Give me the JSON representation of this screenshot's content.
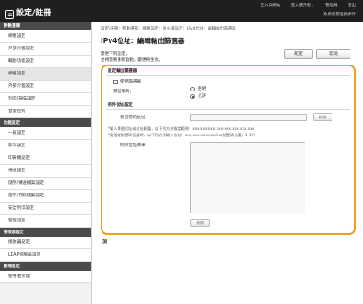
{
  "header": {
    "logo_text": "遠端使用者介面",
    "logo_short": "設定/註冊",
    "links": [
      "至入口網站",
      "登入使用者：",
      "管理員",
      "登出"
    ],
    "sub_link": "致系統管理員郵件"
  },
  "sidebar": {
    "sections": [
      {
        "title": "參數選擇",
        "items": [
          "網路設定",
          "外部介面設定",
          "輔助功能設定",
          "網路設定",
          "外部介面設定",
          "列印/掃描設定",
          "音量控制"
        ]
      },
      {
        "title": "功能設定",
        "items": [
          "一般設定",
          "影印設定",
          "印表機設定",
          "傳送設定",
          "儲存/傳送檔案設定",
          "當存/存取檔案設定",
          "安全列印設定",
          "管理設定"
        ]
      },
      {
        "title": "接收器設定",
        "items": [
          "接收器設定",
          "LDAP伺服器設定"
        ]
      },
      {
        "title": "管理設定",
        "items": [
          "使用者管理"
        ]
      }
    ]
  },
  "main": {
    "breadcrumb": "設定/註冊：參數選擇：網路設定：防火牆設定：IPv4位址：編輯輸出篩選器",
    "title": "IPv4位址：編輯輸出篩選器",
    "desc_line1": "變更下列設定，",
    "desc_line2": "並視需要重新啟動，變更將生效。",
    "apply_label": "確定",
    "cancel_label": "取消",
    "panel": {
      "section_title": "設定輸出篩選器",
      "use_filter_label": "使用篩選器",
      "default_policy_label": "預設策略：",
      "reject_label": "拒絕",
      "allow_label": "允許",
      "allow_selected": true,
      "exception_title": "例外位址設定",
      "addr_label": "要註冊的位址：",
      "add_button": "新增",
      "note1": "*輸入單個位址或位址範圍，以下列方式指定範例：xxx.xxx.xxx.xxx-xxx.xxx.xxx.xxx",
      "note2": "*要指定前置碼長度時，以下列方式輸入位址：xxx.xxx.xxx.xxx/xx(前置碼長度：1-32)",
      "exception_list_label": "例外位址清單：",
      "delete_button": "刪除"
    },
    "top_marker": "頂"
  }
}
